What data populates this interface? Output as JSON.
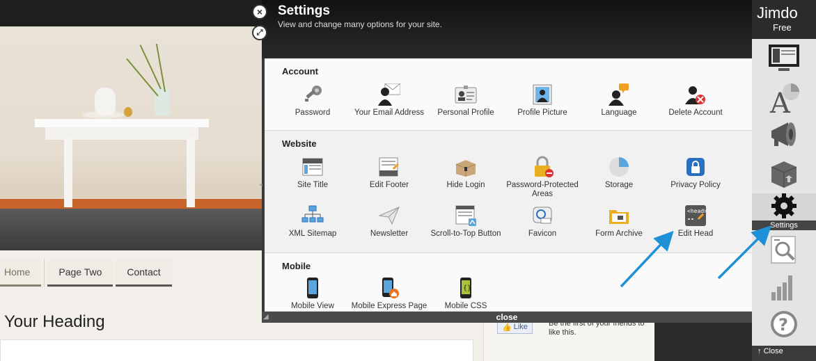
{
  "overlay": {
    "title": "Settings",
    "subtitle": "View and change many options for your site.",
    "close_circle": "×",
    "expand_circle": "⤢",
    "close_bar_label": "close",
    "sections": {
      "account": {
        "title": "Account",
        "items": [
          {
            "label": "Password",
            "icon": "key-icon"
          },
          {
            "label": "Your Email Address",
            "icon": "email-icon"
          },
          {
            "label": "Personal Profile",
            "icon": "id-card-icon"
          },
          {
            "label": "Profile Picture",
            "icon": "portrait-icon"
          },
          {
            "label": "Language",
            "icon": "language-icon"
          },
          {
            "label": "Delete Account",
            "icon": "delete-user-icon"
          }
        ]
      },
      "website": {
        "title": "Website",
        "items": [
          {
            "label": "Site Title",
            "icon": "site-title-icon"
          },
          {
            "label": "Edit Footer",
            "icon": "footer-icon"
          },
          {
            "label": "Hide Login",
            "icon": "box-icon"
          },
          {
            "label": "Password-Protected Areas",
            "icon": "lock-icon"
          },
          {
            "label": "Storage",
            "icon": "pie-icon"
          },
          {
            "label": "Privacy Policy",
            "icon": "shield-lock-icon"
          },
          {
            "label": "XML Sitemap",
            "icon": "sitemap-icon"
          },
          {
            "label": "Newsletter",
            "icon": "paper-plane-icon"
          },
          {
            "label": "Scroll-to-Top Button",
            "icon": "scroll-top-icon"
          },
          {
            "label": "Favicon",
            "icon": "favicon-icon"
          },
          {
            "label": "Form Archive",
            "icon": "folder-icon"
          },
          {
            "label": "Edit Head",
            "icon": "head-code-icon"
          }
        ]
      },
      "mobile": {
        "title": "Mobile",
        "items": [
          {
            "label": "Mobile View",
            "icon": "phone-icon"
          },
          {
            "label": "Mobile Express Page",
            "icon": "phone-home-icon"
          },
          {
            "label": "Mobile CSS",
            "icon": "phone-css-icon"
          }
        ]
      }
    }
  },
  "site": {
    "nav": [
      "Home",
      "Page Two",
      "Contact"
    ],
    "heading": "Your Heading",
    "fb_like": "Like",
    "fb_text": "Be the first of your friends to like this."
  },
  "jimdo": {
    "logo": "Jimdo",
    "plan": "Free",
    "settings_label": "Settings",
    "close_label": "Close"
  },
  "colors": {
    "accent_arrow": "#1e90d8",
    "panel_bg": "#f4f4f4",
    "header_bg": "#1c1c1c"
  }
}
